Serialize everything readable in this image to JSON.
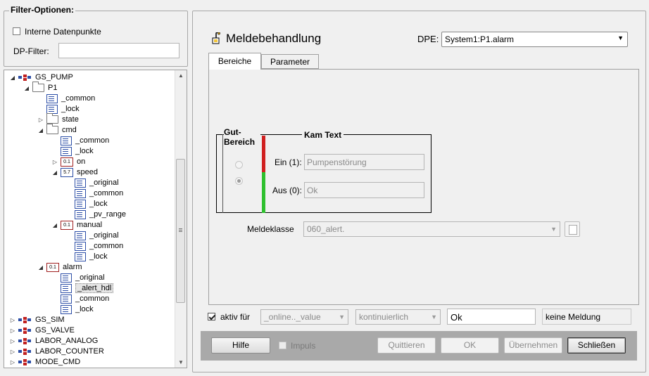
{
  "filter": {
    "legend": "Filter-Optionen:",
    "intern_label": "Interne Datenpunkte",
    "dp_filter_label": "DP-Filter:",
    "dp_filter_value": ""
  },
  "tree": [
    {
      "label": "GS_PUMP",
      "icon": "datapoint-type-icon",
      "exp": "◢"
    },
    {
      "label": "P1",
      "icon": "folder-icon",
      "exp": "◢"
    },
    {
      "label": "_common",
      "icon": "config-icon"
    },
    {
      "label": "_lock",
      "icon": "config-icon"
    },
    {
      "label": "state",
      "icon": "folder-icon",
      "exp": "▷"
    },
    {
      "label": "cmd",
      "icon": "folder-icon",
      "exp": "◢"
    },
    {
      "label": "_common",
      "icon": "config-icon"
    },
    {
      "label": "_lock",
      "icon": "config-icon"
    },
    {
      "label": "on",
      "icon": "bool-icon",
      "exp": "▷",
      "badge": "0.1"
    },
    {
      "label": "speed",
      "icon": "float-icon",
      "exp": "◢",
      "badge": "5.7"
    },
    {
      "label": "_original",
      "icon": "config-icon"
    },
    {
      "label": "_common",
      "icon": "config-icon"
    },
    {
      "label": "_lock",
      "icon": "config-icon"
    },
    {
      "label": "_pv_range",
      "icon": "config-icon"
    },
    {
      "label": "manual",
      "icon": "bool-icon",
      "exp": "◢",
      "badge": "0.1"
    },
    {
      "label": "_original",
      "icon": "config-icon"
    },
    {
      "label": "_common",
      "icon": "config-icon"
    },
    {
      "label": "_lock",
      "icon": "config-icon"
    },
    {
      "label": "alarm",
      "icon": "bool-icon",
      "exp": "◢",
      "badge": "0.1"
    },
    {
      "label": "_original",
      "icon": "config-icon"
    },
    {
      "label": "_alert_hdl",
      "icon": "config-icon",
      "selected": true
    },
    {
      "label": "_common",
      "icon": "config-icon"
    },
    {
      "label": "_lock",
      "icon": "config-icon"
    },
    {
      "label": "GS_SIM",
      "icon": "datapoint-type-icon",
      "exp": "▷"
    },
    {
      "label": "GS_VALVE",
      "icon": "datapoint-type-icon",
      "exp": "▷"
    },
    {
      "label": "LABOR_ANALOG",
      "icon": "datapoint-type-icon",
      "exp": "▷"
    },
    {
      "label": "LABOR_COUNTER",
      "icon": "datapoint-type-icon",
      "exp": "▷"
    },
    {
      "label": "MODE_CMD",
      "icon": "datapoint-type-icon",
      "exp": "▷"
    }
  ],
  "panel": {
    "title": "Meldebehandlung",
    "dpe_label": "DPE:",
    "dpe_value": "System1:P1.alarm",
    "tabs": [
      "Bereiche",
      "Parameter"
    ],
    "gut_bereich": "Gut-\nBereich",
    "kam_text": "Kam Text",
    "ein_label": "Ein (1):",
    "ein_value": "Pumpenstörung",
    "aus_label": "Aus (0):",
    "aus_value": "Ok",
    "meldeklasse_label": "Meldeklasse",
    "meldeklasse_value": "060_alert.",
    "aktiv_label": "aktiv für",
    "online_value": "_online.._value",
    "kont_value": "kontinuierlich",
    "ok_field": "Ok",
    "keine_meldung": "keine Meldung",
    "impuls_label": "Impuls",
    "buttons": {
      "hilfe": "Hilfe",
      "quittieren": "Quittieren",
      "ok": "OK",
      "uebernehmen": "Übernehmen",
      "schliessen": "Schließen"
    }
  },
  "colors": {
    "red_band": "#d02020",
    "green_band": "#2ec02e",
    "accent": "#b8860b"
  }
}
